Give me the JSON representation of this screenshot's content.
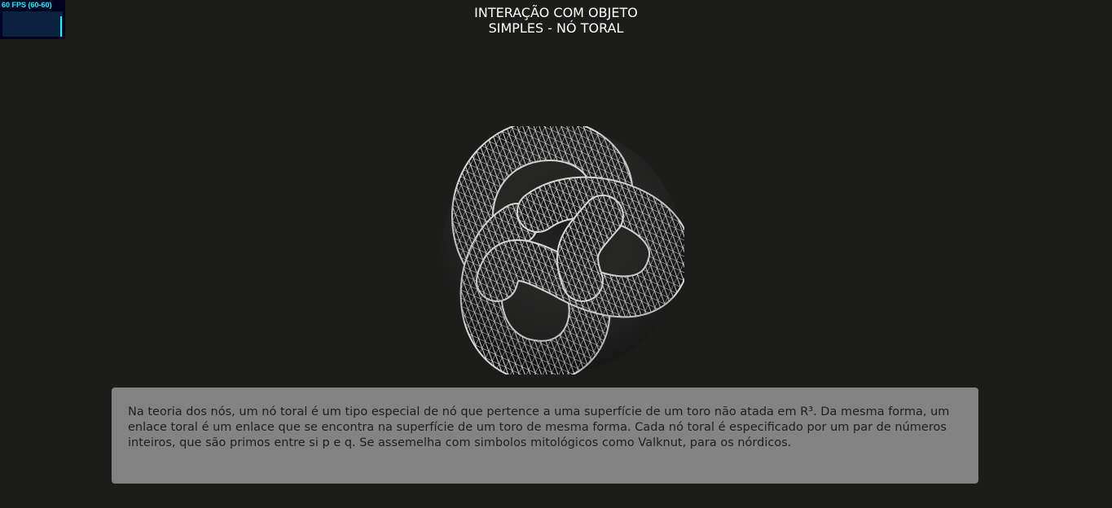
{
  "stats": {
    "label": "60 FPS (60-60)",
    "fps": 60,
    "color": "#00ffff"
  },
  "header": {
    "title_line1": "INTERAÇÃO COM OBJETO",
    "title_line2": "SIMPLES - NÓ TORAL"
  },
  "scene": {
    "object": "torus-knot",
    "material": "wireframe",
    "wire_color": "#ffffff",
    "background": "#1c1c1b"
  },
  "description": {
    "text": "Na teoria dos nós, um nó toral é um tipo especial de nó que pertence a uma superfície de um toro não atada em R³. Da mesma forma, um enlace toral é um enlace que se encontra na superfície de um toro de mesma forma. Cada nó toral é especificado por um par de números inteiros, que são primos entre si p e q. Se assemelha com simbolos mitológicos como Valknut, para os nórdicos."
  }
}
